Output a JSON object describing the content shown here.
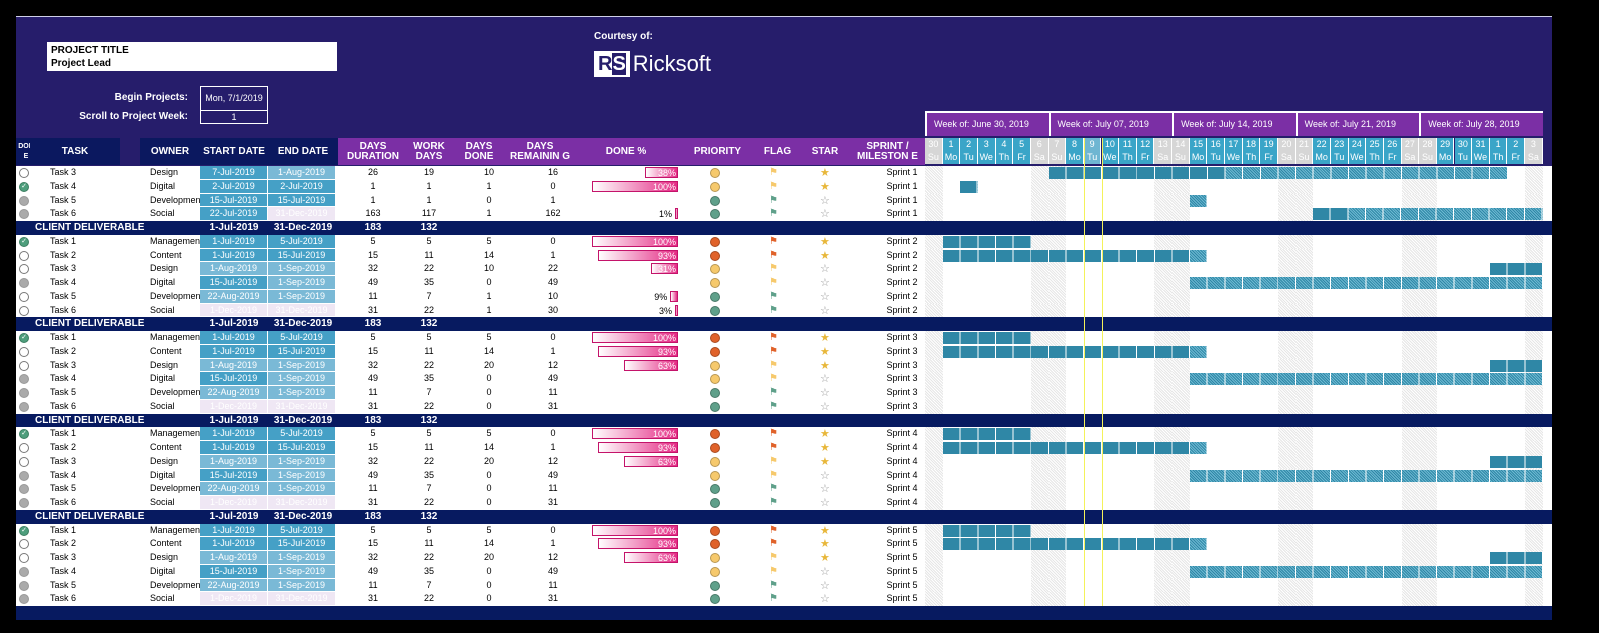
{
  "header": {
    "project_title": "PROJECT TITLE",
    "project_lead": "Project Lead",
    "begin_label": "Begin Projects:",
    "begin_value": "Mon, 7/1/2019",
    "scroll_label": "Scroll to Project Week:",
    "scroll_value": "1",
    "courtesy": "Courtesy of:",
    "logo_mark": "RS",
    "logo_name": "Ricksoft"
  },
  "columns": {
    "done": "DON E",
    "task": "TASK",
    "owner": "OWNER",
    "start": "START DATE",
    "end": "END DATE",
    "duration": "DAYS DURATION",
    "work_days": "WORK DAYS",
    "days_done": "DAYS DONE",
    "days_remaining": "DAYS REMAININ G",
    "done_pct": "DONE %",
    "priority": "PRIORITY",
    "flag": "FLAG",
    "star": "STAR",
    "sprint": "SPRINT / MILESTON E"
  },
  "colors": {
    "priority_high": "#e0622a",
    "priority_medium": "#f6c96c",
    "priority_low": "#5fa08a",
    "bar_done": "#2f87a6",
    "bar_remaining": "#3f9fbf",
    "today_line": "#f4f25a"
  },
  "timeline": {
    "weeks": [
      "Week of: June 30, 2019",
      "Week of: July 07, 2019",
      "Week of: July 14, 2019",
      "Week of: July 21, 2019",
      "Week of: July 28, 2019"
    ],
    "day_numbers": [
      "30",
      "1",
      "2",
      "3",
      "4",
      "5",
      "6",
      "7",
      "8",
      "9",
      "10",
      "11",
      "12",
      "13",
      "14",
      "15",
      "16",
      "17",
      "18",
      "19",
      "20",
      "21",
      "22",
      "23",
      "24",
      "25",
      "26",
      "27",
      "28",
      "29",
      "30",
      "31",
      "1",
      "2",
      "3"
    ],
    "day_names": [
      "Su",
      "Mo",
      "Tu",
      "We",
      "Th",
      "Fr",
      "Sa"
    ],
    "start_date": "2019-06-30",
    "today_date": "2019-07-09"
  },
  "sections": [
    {
      "summary": null,
      "tasks": [
        {
          "status": "open",
          "task": "Task 3",
          "owner": "Design",
          "start": "7-Jul-2019",
          "end": "1-Aug-2019",
          "duration": "26",
          "work_days": "19",
          "days_done": "10",
          "days_remaining": "16",
          "done_pct": "38%",
          "priority": "medium",
          "flag": "medium",
          "star": "half",
          "sprint": "Sprint 1"
        },
        {
          "status": "checked",
          "task": "Task 4",
          "owner": "Digital",
          "start": "2-Jul-2019",
          "end": "2-Jul-2019",
          "duration": "1",
          "work_days": "1",
          "days_done": "1",
          "days_remaining": "0",
          "done_pct": "100%",
          "priority": "medium",
          "flag": "medium",
          "star": "full",
          "sprint": "Sprint 1"
        },
        {
          "status": "gray",
          "task": "Task 5",
          "owner": "Development",
          "start": "15-Jul-2019",
          "end": "15-Jul-2019",
          "duration": "1",
          "work_days": "1",
          "days_done": "0",
          "days_remaining": "1",
          "done_pct": "",
          "priority": "low",
          "flag": "low",
          "star": "empty",
          "sprint": "Sprint 1"
        },
        {
          "status": "gray",
          "task": "Task 6",
          "owner": "Social",
          "start": "22-Jul-2019",
          "end": "31-Dec-2019",
          "duration": "163",
          "work_days": "117",
          "days_done": "1",
          "days_remaining": "162",
          "done_pct": "1%",
          "priority": "low",
          "flag": "low",
          "star": "empty",
          "sprint": "Sprint 1"
        }
      ]
    },
    {
      "summary": {
        "label": "CLIENT DELIVERABLE",
        "start": "1-Jul-2019",
        "end": "31-Dec-2019",
        "duration": "183",
        "work_days": "132"
      },
      "tasks": [
        {
          "status": "checked",
          "task": "Task 1",
          "owner": "Management",
          "start": "1-Jul-2019",
          "end": "5-Jul-2019",
          "duration": "5",
          "work_days": "5",
          "days_done": "5",
          "days_remaining": "0",
          "done_pct": "100%",
          "priority": "high",
          "flag": "high",
          "star": "full",
          "sprint": "Sprint 2"
        },
        {
          "status": "open",
          "task": "Task 2",
          "owner": "Content",
          "start": "1-Jul-2019",
          "end": "15-Jul-2019",
          "duration": "15",
          "work_days": "11",
          "days_done": "14",
          "days_remaining": "1",
          "done_pct": "93%",
          "priority": "high",
          "flag": "high",
          "star": "full",
          "sprint": "Sprint 2"
        },
        {
          "status": "open",
          "task": "Task 3",
          "owner": "Design",
          "start": "1-Aug-2019",
          "end": "1-Sep-2019",
          "duration": "32",
          "work_days": "22",
          "days_done": "10",
          "days_remaining": "22",
          "done_pct": "31%",
          "priority": "medium",
          "flag": "medium",
          "star": "empty",
          "sprint": "Sprint 2"
        },
        {
          "status": "gray",
          "task": "Task 4",
          "owner": "Digital",
          "start": "15-Jul-2019",
          "end": "1-Sep-2019",
          "duration": "49",
          "work_days": "35",
          "days_done": "0",
          "days_remaining": "49",
          "done_pct": "",
          "priority": "medium",
          "flag": "medium",
          "star": "empty",
          "sprint": "Sprint 2"
        },
        {
          "status": "open",
          "task": "Task 5",
          "owner": "Development",
          "start": "22-Aug-2019",
          "end": "1-Sep-2019",
          "duration": "11",
          "work_days": "7",
          "days_done": "1",
          "days_remaining": "10",
          "done_pct": "9%",
          "priority": "low",
          "flag": "low",
          "star": "empty",
          "sprint": "Sprint 2"
        },
        {
          "status": "open",
          "task": "Task 6",
          "owner": "Social",
          "start": "1-Dec-2019",
          "end": "31-Dec-2019",
          "duration": "31",
          "work_days": "22",
          "days_done": "1",
          "days_remaining": "30",
          "done_pct": "3%",
          "priority": "low",
          "flag": "low",
          "star": "empty",
          "sprint": "Sprint 2"
        }
      ]
    },
    {
      "summary": {
        "label": "CLIENT DELIVERABLE",
        "start": "1-Jul-2019",
        "end": "31-Dec-2019",
        "duration": "183",
        "work_days": "132"
      },
      "tasks": [
        {
          "status": "checked",
          "task": "Task 1",
          "owner": "Management",
          "start": "1-Jul-2019",
          "end": "5-Jul-2019",
          "duration": "5",
          "work_days": "5",
          "days_done": "5",
          "days_remaining": "0",
          "done_pct": "100%",
          "priority": "high",
          "flag": "high",
          "star": "full",
          "sprint": "Sprint 3"
        },
        {
          "status": "open",
          "task": "Task 2",
          "owner": "Content",
          "start": "1-Jul-2019",
          "end": "15-Jul-2019",
          "duration": "15",
          "work_days": "11",
          "days_done": "14",
          "days_remaining": "1",
          "done_pct": "93%",
          "priority": "high",
          "flag": "high",
          "star": "full",
          "sprint": "Sprint 3"
        },
        {
          "status": "open",
          "task": "Task 3",
          "owner": "Design",
          "start": "1-Aug-2019",
          "end": "1-Sep-2019",
          "duration": "32",
          "work_days": "22",
          "days_done": "20",
          "days_remaining": "12",
          "done_pct": "63%",
          "priority": "medium",
          "flag": "medium",
          "star": "half",
          "sprint": "Sprint 3"
        },
        {
          "status": "gray",
          "task": "Task 4",
          "owner": "Digital",
          "start": "15-Jul-2019",
          "end": "1-Sep-2019",
          "duration": "49",
          "work_days": "35",
          "days_done": "0",
          "days_remaining": "49",
          "done_pct": "",
          "priority": "medium",
          "flag": "medium",
          "star": "empty",
          "sprint": "Sprint 3"
        },
        {
          "status": "gray",
          "task": "Task 5",
          "owner": "Development",
          "start": "22-Aug-2019",
          "end": "1-Sep-2019",
          "duration": "11",
          "work_days": "7",
          "days_done": "0",
          "days_remaining": "11",
          "done_pct": "",
          "priority": "low",
          "flag": "low",
          "star": "empty",
          "sprint": "Sprint 3"
        },
        {
          "status": "gray",
          "task": "Task 6",
          "owner": "Social",
          "start": "1-Dec-2019",
          "end": "31-Dec-2019",
          "duration": "31",
          "work_days": "22",
          "days_done": "0",
          "days_remaining": "31",
          "done_pct": "",
          "priority": "low",
          "flag": "low",
          "star": "empty",
          "sprint": "Sprint 3"
        }
      ]
    },
    {
      "summary": {
        "label": "CLIENT DELIVERABLE",
        "start": "1-Jul-2019",
        "end": "31-Dec-2019",
        "duration": "183",
        "work_days": "132"
      },
      "tasks": [
        {
          "status": "checked",
          "task": "Task 1",
          "owner": "Management",
          "start": "1-Jul-2019",
          "end": "5-Jul-2019",
          "duration": "5",
          "work_days": "5",
          "days_done": "5",
          "days_remaining": "0",
          "done_pct": "100%",
          "priority": "high",
          "flag": "high",
          "star": "full",
          "sprint": "Sprint 4"
        },
        {
          "status": "open",
          "task": "Task 2",
          "owner": "Content",
          "start": "1-Jul-2019",
          "end": "15-Jul-2019",
          "duration": "15",
          "work_days": "11",
          "days_done": "14",
          "days_remaining": "1",
          "done_pct": "93%",
          "priority": "high",
          "flag": "high",
          "star": "full",
          "sprint": "Sprint 4"
        },
        {
          "status": "open",
          "task": "Task 3",
          "owner": "Design",
          "start": "1-Aug-2019",
          "end": "1-Sep-2019",
          "duration": "32",
          "work_days": "22",
          "days_done": "20",
          "days_remaining": "12",
          "done_pct": "63%",
          "priority": "medium",
          "flag": "medium",
          "star": "half",
          "sprint": "Sprint 4"
        },
        {
          "status": "gray",
          "task": "Task 4",
          "owner": "Digital",
          "start": "15-Jul-2019",
          "end": "1-Sep-2019",
          "duration": "49",
          "work_days": "35",
          "days_done": "0",
          "days_remaining": "49",
          "done_pct": "",
          "priority": "medium",
          "flag": "medium",
          "star": "empty",
          "sprint": "Sprint 4"
        },
        {
          "status": "gray",
          "task": "Task 5",
          "owner": "Development",
          "start": "22-Aug-2019",
          "end": "1-Sep-2019",
          "duration": "11",
          "work_days": "7",
          "days_done": "0",
          "days_remaining": "11",
          "done_pct": "",
          "priority": "low",
          "flag": "low",
          "star": "empty",
          "sprint": "Sprint 4"
        },
        {
          "status": "gray",
          "task": "Task 6",
          "owner": "Social",
          "start": "1-Dec-2019",
          "end": "31-Dec-2019",
          "duration": "31",
          "work_days": "22",
          "days_done": "0",
          "days_remaining": "31",
          "done_pct": "",
          "priority": "low",
          "flag": "low",
          "star": "empty",
          "sprint": "Sprint 4"
        }
      ]
    },
    {
      "summary": {
        "label": "CLIENT DELIVERABLE",
        "start": "1-Jul-2019",
        "end": "31-Dec-2019",
        "duration": "183",
        "work_days": "132"
      },
      "tasks": [
        {
          "status": "checked",
          "task": "Task 1",
          "owner": "Management",
          "start": "1-Jul-2019",
          "end": "5-Jul-2019",
          "duration": "5",
          "work_days": "5",
          "days_done": "5",
          "days_remaining": "0",
          "done_pct": "100%",
          "priority": "high",
          "flag": "high",
          "star": "full",
          "sprint": "Sprint 5"
        },
        {
          "status": "open",
          "task": "Task 2",
          "owner": "Content",
          "start": "1-Jul-2019",
          "end": "15-Jul-2019",
          "duration": "15",
          "work_days": "11",
          "days_done": "14",
          "days_remaining": "1",
          "done_pct": "93%",
          "priority": "high",
          "flag": "high",
          "star": "full",
          "sprint": "Sprint 5"
        },
        {
          "status": "open",
          "task": "Task 3",
          "owner": "Design",
          "start": "1-Aug-2019",
          "end": "1-Sep-2019",
          "duration": "32",
          "work_days": "22",
          "days_done": "20",
          "days_remaining": "12",
          "done_pct": "63%",
          "priority": "medium",
          "flag": "medium",
          "star": "half",
          "sprint": "Sprint 5"
        },
        {
          "status": "gray",
          "task": "Task 4",
          "owner": "Digital",
          "start": "15-Jul-2019",
          "end": "1-Sep-2019",
          "duration": "49",
          "work_days": "35",
          "days_done": "0",
          "days_remaining": "49",
          "done_pct": "",
          "priority": "medium",
          "flag": "medium",
          "star": "empty",
          "sprint": "Sprint 5"
        },
        {
          "status": "gray",
          "task": "Task 5",
          "owner": "Development",
          "start": "22-Aug-2019",
          "end": "1-Sep-2019",
          "duration": "11",
          "work_days": "7",
          "days_done": "0",
          "days_remaining": "11",
          "done_pct": "",
          "priority": "low",
          "flag": "low",
          "star": "empty",
          "sprint": "Sprint 5"
        },
        {
          "status": "gray",
          "task": "Task 6",
          "owner": "Social",
          "start": "1-Dec-2019",
          "end": "31-Dec-2019",
          "duration": "31",
          "work_days": "22",
          "days_done": "0",
          "days_remaining": "31",
          "done_pct": "",
          "priority": "low",
          "flag": "low",
          "star": "empty",
          "sprint": "Sprint 5"
        }
      ]
    }
  ]
}
